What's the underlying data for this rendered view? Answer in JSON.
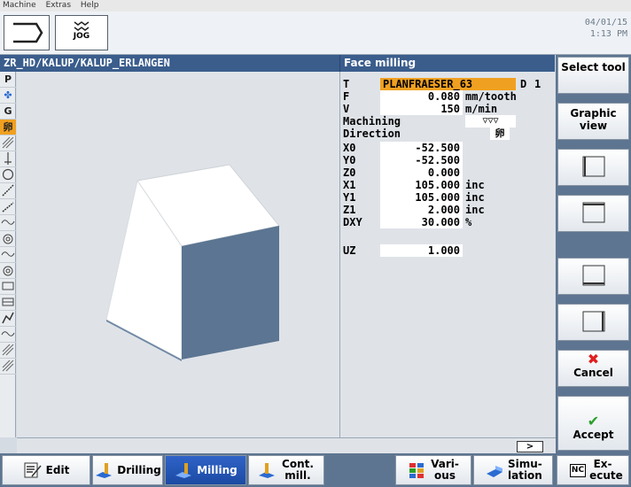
{
  "menubar": [
    "Machine",
    "Extras",
    "Help"
  ],
  "header": {
    "mode_label": "JOG",
    "date": "04/01/15",
    "time": "1:13 PM"
  },
  "path": "ZR_HD/KALUP/KALUP_ERLANGEN",
  "form": {
    "title": "Face milling",
    "t_label": "T",
    "t_value": "PLANFRAESER_63",
    "d_label": "D",
    "d_value": "1",
    "f_label": "F",
    "f_value": "0.080",
    "f_unit": "mm/tooth",
    "v_label": "V",
    "v_value": "150",
    "v_unit": "m/min",
    "machining_label": "Machining",
    "machining_value": "▽▽▽",
    "direction_label": "Direction",
    "direction_value": "卵",
    "rows": [
      {
        "label": "X0",
        "value": "-52.500",
        "unit": ""
      },
      {
        "label": "Y0",
        "value": "-52.500",
        "unit": ""
      },
      {
        "label": "Z0",
        "value": "0.000",
        "unit": ""
      },
      {
        "label": "X1",
        "value": "105.000",
        "unit": "inc"
      },
      {
        "label": "Y1",
        "value": "105.000",
        "unit": "inc"
      },
      {
        "label": "Z1",
        "value": "2.000",
        "unit": "inc"
      },
      {
        "label": "DXY",
        "value": "30.000",
        "unit": "%"
      }
    ],
    "uz_label": "UZ",
    "uz_value": "1.000"
  },
  "toolstrip": [
    "P",
    "✤",
    "G",
    "卵"
  ],
  "softkeys": {
    "select_tool": "Select tool",
    "graphic_view": "Graphic view",
    "cancel": "Cancel",
    "accept": "Accept"
  },
  "scroll": ">",
  "hkeys": {
    "edit": "Edit",
    "drilling": "Drilling",
    "milling": "Milling",
    "cont_mill": "Cont. mill.",
    "various": "Vari- ous",
    "simulation": "Simu- lation",
    "execute": "Ex- ecute",
    "nc_badge": "NC"
  },
  "colors": {
    "accent": "#f0a020",
    "header_blue": "#3a5d8c",
    "softkey_bg": "#5e7591"
  }
}
